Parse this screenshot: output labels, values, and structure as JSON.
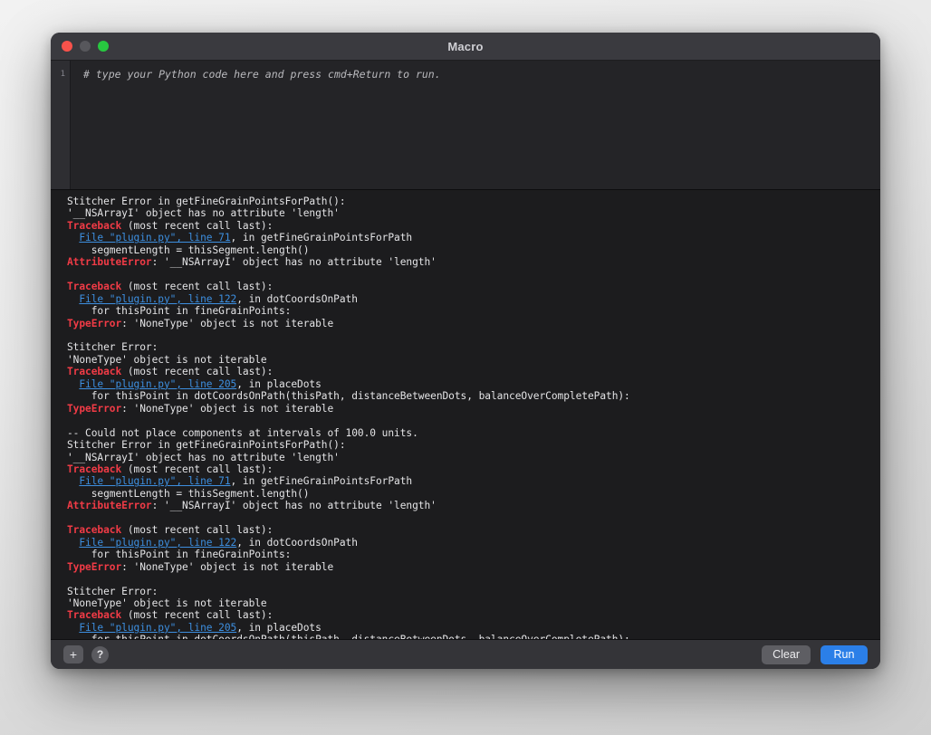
{
  "window": {
    "title": "Macro",
    "traffic_lights": [
      {
        "name": "close",
        "color": "#f9524b"
      },
      {
        "name": "minimize",
        "color": "#57575c"
      },
      {
        "name": "zoom",
        "color": "#28c840"
      }
    ]
  },
  "editor": {
    "line_numbers": [
      "1"
    ],
    "placeholder": "# type your Python code here and press cmd+Return to run."
  },
  "console": {
    "lines": [
      {
        "segments": [
          {
            "text": "Stitcher Error in getFineGrainPointsForPath():",
            "style": "plain"
          }
        ]
      },
      {
        "segments": [
          {
            "text": "'__NSArrayI' object has no attribute 'length'",
            "style": "plain"
          }
        ]
      },
      {
        "segments": [
          {
            "text": "Traceback",
            "style": "error"
          },
          {
            "text": " (most recent call last):",
            "style": "plain"
          }
        ]
      },
      {
        "segments": [
          {
            "text": "  ",
            "style": "plain"
          },
          {
            "text": "File \"plugin.py\", line 71",
            "style": "link"
          },
          {
            "text": ", in getFineGrainPointsForPath",
            "style": "plain"
          }
        ]
      },
      {
        "segments": [
          {
            "text": "    segmentLength = thisSegment.length()",
            "style": "plain"
          }
        ]
      },
      {
        "segments": [
          {
            "text": "AttributeError",
            "style": "error"
          },
          {
            "text": ": '__NSArrayI' object has no attribute 'length'",
            "style": "plain"
          }
        ]
      },
      {
        "segments": [
          {
            "text": "",
            "style": "plain"
          }
        ]
      },
      {
        "segments": [
          {
            "text": "Traceback",
            "style": "error"
          },
          {
            "text": " (most recent call last):",
            "style": "plain"
          }
        ]
      },
      {
        "segments": [
          {
            "text": "  ",
            "style": "plain"
          },
          {
            "text": "File \"plugin.py\", line 122",
            "style": "link"
          },
          {
            "text": ", in dotCoordsOnPath",
            "style": "plain"
          }
        ]
      },
      {
        "segments": [
          {
            "text": "    for thisPoint in fineGrainPoints:",
            "style": "plain"
          }
        ]
      },
      {
        "segments": [
          {
            "text": "TypeError",
            "style": "error"
          },
          {
            "text": ": 'NoneType' object is not iterable",
            "style": "plain"
          }
        ]
      },
      {
        "segments": [
          {
            "text": "",
            "style": "plain"
          }
        ]
      },
      {
        "segments": [
          {
            "text": "Stitcher Error:",
            "style": "plain"
          }
        ]
      },
      {
        "segments": [
          {
            "text": "'NoneType' object is not iterable",
            "style": "plain"
          }
        ]
      },
      {
        "segments": [
          {
            "text": "Traceback",
            "style": "error"
          },
          {
            "text": " (most recent call last):",
            "style": "plain"
          }
        ]
      },
      {
        "segments": [
          {
            "text": "  ",
            "style": "plain"
          },
          {
            "text": "File \"plugin.py\", line 205",
            "style": "link"
          },
          {
            "text": ", in placeDots",
            "style": "plain"
          }
        ]
      },
      {
        "segments": [
          {
            "text": "    for thisPoint in dotCoordsOnPath(thisPath, distanceBetweenDots, balanceOverCompletePath):",
            "style": "plain"
          }
        ]
      },
      {
        "segments": [
          {
            "text": "TypeError",
            "style": "error"
          },
          {
            "text": ": 'NoneType' object is not iterable",
            "style": "plain"
          }
        ]
      },
      {
        "segments": [
          {
            "text": "",
            "style": "plain"
          }
        ]
      },
      {
        "segments": [
          {
            "text": "-- Could not place components at intervals of 100.0 units.",
            "style": "plain"
          }
        ]
      },
      {
        "segments": [
          {
            "text": "Stitcher Error in getFineGrainPointsForPath():",
            "style": "plain"
          }
        ]
      },
      {
        "segments": [
          {
            "text": "'__NSArrayI' object has no attribute 'length'",
            "style": "plain"
          }
        ]
      },
      {
        "segments": [
          {
            "text": "Traceback",
            "style": "error"
          },
          {
            "text": " (most recent call last):",
            "style": "plain"
          }
        ]
      },
      {
        "segments": [
          {
            "text": "  ",
            "style": "plain"
          },
          {
            "text": "File \"plugin.py\", line 71",
            "style": "link"
          },
          {
            "text": ", in getFineGrainPointsForPath",
            "style": "plain"
          }
        ]
      },
      {
        "segments": [
          {
            "text": "    segmentLength = thisSegment.length()",
            "style": "plain"
          }
        ]
      },
      {
        "segments": [
          {
            "text": "AttributeError",
            "style": "error"
          },
          {
            "text": ": '__NSArrayI' object has no attribute 'length'",
            "style": "plain"
          }
        ]
      },
      {
        "segments": [
          {
            "text": "",
            "style": "plain"
          }
        ]
      },
      {
        "segments": [
          {
            "text": "Traceback",
            "style": "error"
          },
          {
            "text": " (most recent call last):",
            "style": "plain"
          }
        ]
      },
      {
        "segments": [
          {
            "text": "  ",
            "style": "plain"
          },
          {
            "text": "File \"plugin.py\", line 122",
            "style": "link"
          },
          {
            "text": ", in dotCoordsOnPath",
            "style": "plain"
          }
        ]
      },
      {
        "segments": [
          {
            "text": "    for thisPoint in fineGrainPoints:",
            "style": "plain"
          }
        ]
      },
      {
        "segments": [
          {
            "text": "TypeError",
            "style": "error"
          },
          {
            "text": ": 'NoneType' object is not iterable",
            "style": "plain"
          }
        ]
      },
      {
        "segments": [
          {
            "text": "",
            "style": "plain"
          }
        ]
      },
      {
        "segments": [
          {
            "text": "Stitcher Error:",
            "style": "plain"
          }
        ]
      },
      {
        "segments": [
          {
            "text": "'NoneType' object is not iterable",
            "style": "plain"
          }
        ]
      },
      {
        "segments": [
          {
            "text": "Traceback",
            "style": "error"
          },
          {
            "text": " (most recent call last):",
            "style": "plain"
          }
        ]
      },
      {
        "segments": [
          {
            "text": "  ",
            "style": "plain"
          },
          {
            "text": "File \"plugin.py\", line 205",
            "style": "link"
          },
          {
            "text": ", in placeDots",
            "style": "plain"
          }
        ]
      },
      {
        "segments": [
          {
            "text": "    for thisPoint in dotCoordsOnPath(thisPath, distanceBetweenDots, balanceOverCompletePath):",
            "style": "plain"
          }
        ]
      }
    ]
  },
  "toolbar": {
    "add_label": "+",
    "help_label": "?",
    "clear_label": "Clear",
    "run_label": "Run"
  },
  "colors": {
    "accent_run": "#2b7fe8",
    "error_text": "#f03b46",
    "link_text": "#3d8fe0",
    "console_bg": "#1c1c1e",
    "editor_bg": "#242427",
    "titlebar_bg": "#3a3a3f",
    "toolbar_bg": "#343438"
  }
}
